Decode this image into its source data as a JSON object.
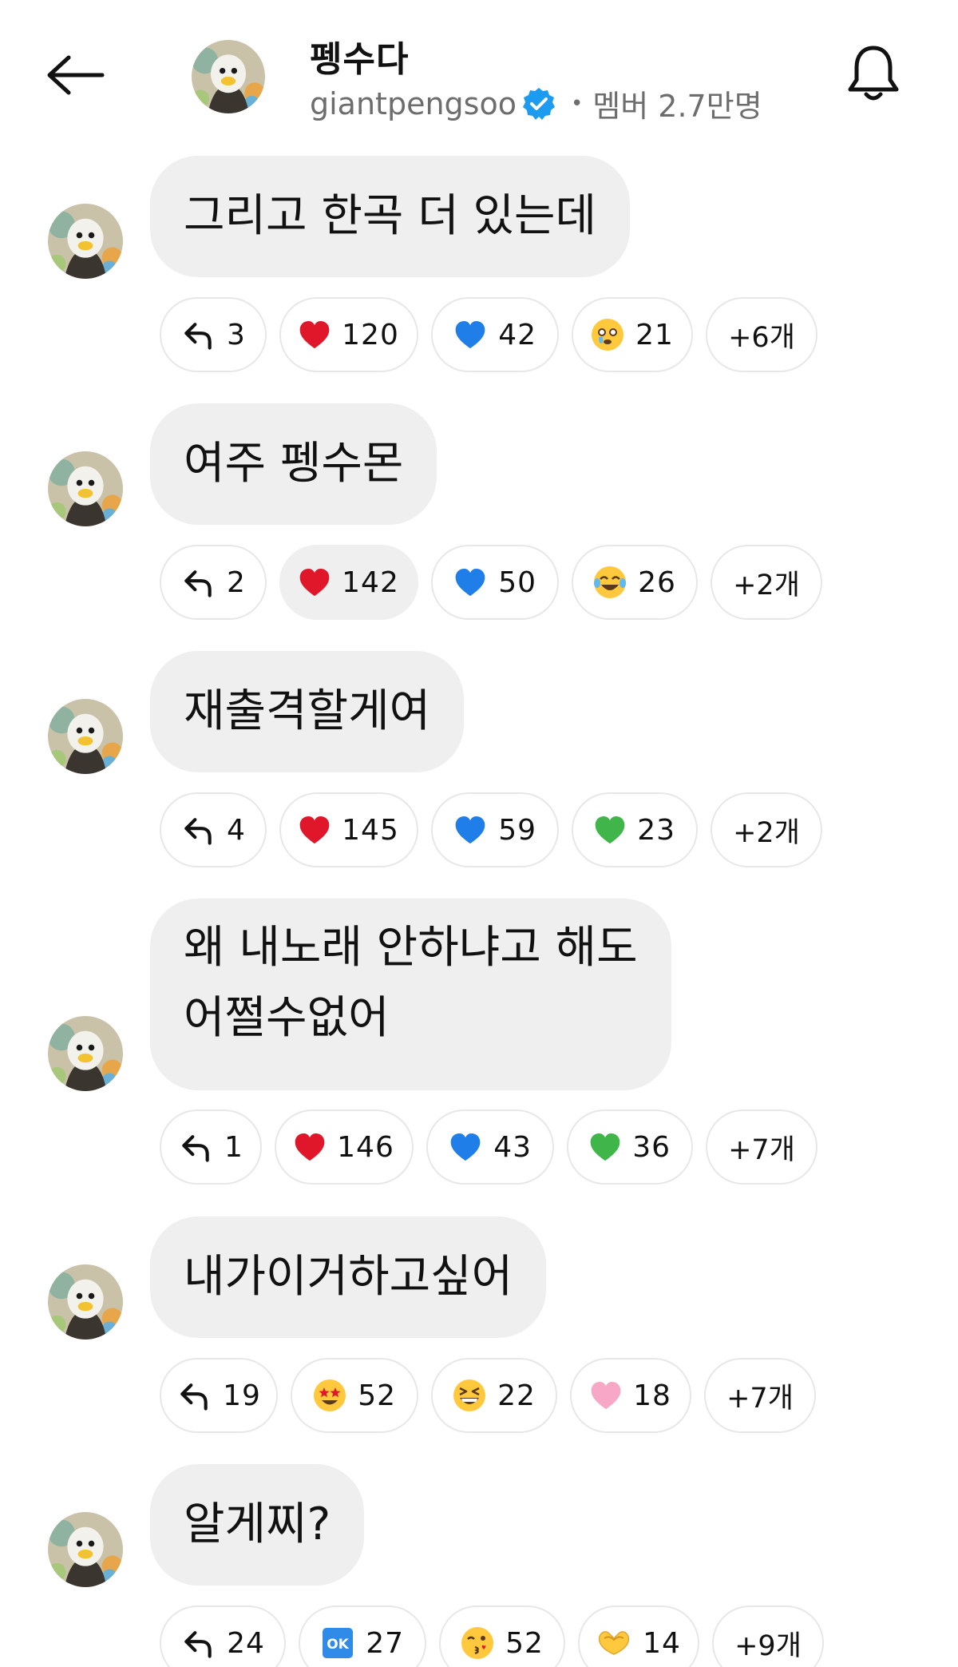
{
  "header": {
    "title": "펭수다",
    "handle": "giantpengsoo",
    "members": "멤버 2.7만명",
    "back_icon": "back-arrow-icon",
    "bell_icon": "bell-icon"
  },
  "colors": {
    "bubble_bg": "#efefef",
    "chip_border": "#e7e7e7",
    "verified_blue": "#1d9bf0",
    "red_heart": "#e0162b",
    "blue_heart": "#1f7ee8",
    "green_heart": "#3fb54a",
    "pink_heart": "#f7a8c6"
  },
  "messages": [
    {
      "text": "그리고 한곡 더 있는데",
      "reactions": [
        {
          "icon": "reply-icon",
          "count": "3"
        },
        {
          "icon": "red-heart-icon",
          "count": "120"
        },
        {
          "icon": "blue-heart-icon",
          "count": "42"
        },
        {
          "icon": "crying-face-icon",
          "count": "21"
        }
      ],
      "more": "+6개"
    },
    {
      "text": "여주 펭수몬",
      "reactions": [
        {
          "icon": "reply-icon",
          "count": "2"
        },
        {
          "icon": "red-heart-icon",
          "count": "142"
        },
        {
          "icon": "blue-heart-icon",
          "count": "50"
        },
        {
          "icon": "tears-of-joy-icon",
          "count": "26"
        }
      ],
      "more": "+2개"
    },
    {
      "text": "재출격할게여",
      "reactions": [
        {
          "icon": "reply-icon",
          "count": "4"
        },
        {
          "icon": "red-heart-icon",
          "count": "145"
        },
        {
          "icon": "blue-heart-icon",
          "count": "59"
        },
        {
          "icon": "green-heart-icon",
          "count": "23"
        }
      ],
      "more": "+2개"
    },
    {
      "text_line1": "왜 내노래 안하냐고 해도",
      "text_line2": "어쩔수없어",
      "reactions": [
        {
          "icon": "reply-icon",
          "count": "1"
        },
        {
          "icon": "red-heart-icon",
          "count": "146"
        },
        {
          "icon": "blue-heart-icon",
          "count": "43"
        },
        {
          "icon": "green-heart-icon",
          "count": "36"
        }
      ],
      "more": "+7개"
    },
    {
      "text": "내가이거하고싶어",
      "reactions": [
        {
          "icon": "reply-icon",
          "count": "19"
        },
        {
          "icon": "star-struck-icon",
          "count": "52"
        },
        {
          "icon": "grinning-squinting-icon",
          "count": "22"
        },
        {
          "icon": "pink-heart-icon",
          "count": "18"
        }
      ],
      "more": "+7개"
    },
    {
      "text": "알게찌?",
      "reactions": [
        {
          "icon": "reply-icon",
          "count": "24"
        },
        {
          "icon": "ok-button-icon",
          "count": "27",
          "label": "OK"
        },
        {
          "icon": "kissing-face-icon",
          "count": "52"
        },
        {
          "icon": "heart-hands-icon",
          "count": "14"
        }
      ],
      "more": "+9개"
    }
  ]
}
